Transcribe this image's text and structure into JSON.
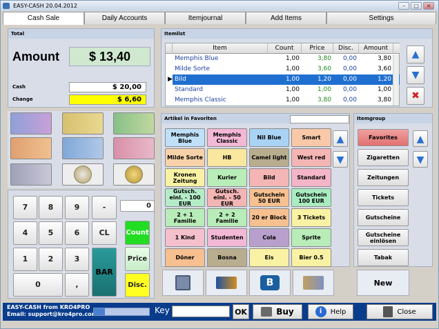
{
  "window": {
    "title": "EASY-CASH 20.04.2012",
    "controls": [
      "–",
      "□",
      "×"
    ]
  },
  "tabs": [
    {
      "label": "Cash Sale",
      "active": true
    },
    {
      "label": "Daily Accounts",
      "active": false
    },
    {
      "label": "Itemjournal",
      "active": false
    },
    {
      "label": "Add Items",
      "active": false
    },
    {
      "label": "Settings",
      "active": false
    }
  ],
  "total": {
    "header": "Total",
    "amount_label": "Amount",
    "amount_value": "$ 13,40",
    "cash_label": "Cash",
    "cash_value": "$ 20,00",
    "change_label": "Change",
    "change_value": "$ 6,60"
  },
  "itemlist": {
    "header": "Itemlist",
    "columns": [
      "Item",
      "Count",
      "Price",
      "Disc.",
      "Amount"
    ],
    "rows": [
      {
        "item": "Memphis Blue",
        "count": "1,00",
        "price": "3,80",
        "disc": "0,00",
        "amount": "3,80",
        "selected": false
      },
      {
        "item": "Milde Sorte",
        "count": "1,00",
        "price": "3,60",
        "disc": "0,00",
        "amount": "3,60",
        "selected": false
      },
      {
        "item": "Bild",
        "count": "1,00",
        "price": "1,20",
        "disc": "0,00",
        "amount": "1,20",
        "selected": true
      },
      {
        "item": "Standard",
        "count": "1,00",
        "price": "1,00",
        "disc": "0,00",
        "amount": "1,00",
        "selected": false
      },
      {
        "item": "Memphis  Classic",
        "count": "1,00",
        "price": "3,80",
        "disc": "0,00",
        "amount": "3,80",
        "selected": false
      }
    ]
  },
  "keypad": {
    "display": "0",
    "keys": [
      "7",
      "8",
      "9",
      "-",
      "4",
      "5",
      "6",
      "CL",
      "1",
      "2",
      "3",
      "BAR",
      "0",
      ","
    ],
    "count_label": "Count",
    "price_label": "Price",
    "disc_label": "Disc."
  },
  "favorites": {
    "header": "Artikel in Favoriten",
    "items": [
      {
        "label": "Memphis Blue",
        "color": "#bfe0f8"
      },
      {
        "label": "Memphis Classic",
        "color": "#f2b8d6"
      },
      {
        "label": "Nil Blue",
        "color": "#a9d3f5"
      },
      {
        "label": "Smart",
        "color": "#f8c8a8"
      },
      {
        "label": "Milde Sorte",
        "color": "#f7d2a8"
      },
      {
        "label": "HB",
        "color": "#f9e7a0"
      },
      {
        "label": "Camel light",
        "color": "#b8ad8e"
      },
      {
        "label": "West red",
        "color": "#f4b5b5"
      },
      {
        "label": "Kronen Zeitung",
        "color": "#f9f2a4"
      },
      {
        "label": "Kurier",
        "color": "#b8ecb8"
      },
      {
        "label": "Bild",
        "color": "#f4b5b5"
      },
      {
        "label": "Standard",
        "color": "#f4b5c8"
      },
      {
        "label": "Gutsch. einl. - 100 EUR",
        "color": "#b5ecc8"
      },
      {
        "label": "Gutsch. einl. - 50 EUR",
        "color": "#f4b5b5"
      },
      {
        "label": "Gutschein 50 EUR",
        "color": "#f7c090"
      },
      {
        "label": "Gutschein 100 EUR",
        "color": "#a8ecc0"
      },
      {
        "label": "2 + 1 Familie",
        "color": "#b8ecb8"
      },
      {
        "label": "2 + 2 Familie",
        "color": "#b8ecb8"
      },
      {
        "label": "20 er Block",
        "color": "#f7c090"
      },
      {
        "label": "3 Tickets",
        "color": "#f9f2a4"
      },
      {
        "label": "1 Kind",
        "color": "#f4c0cc"
      },
      {
        "label": "Studenten",
        "color": "#f2b8d6"
      },
      {
        "label": "Cola",
        "color": "#b8a0cc"
      },
      {
        "label": "Sprite",
        "color": "#b8ecb8"
      },
      {
        "label": "Döner",
        "color": "#f7c090"
      },
      {
        "label": "Bosna",
        "color": "#b8ad8e"
      },
      {
        "label": "Eis",
        "color": "#f9f2a4"
      },
      {
        "label": "Bier 0.5",
        "color": "#f9f2a4"
      }
    ]
  },
  "itemgroup": {
    "header": "Itemgroup",
    "items": [
      "Favorites",
      "Zigaretten",
      "Zeitungen",
      "Tickets",
      "Gutscheine",
      "Gutscheine einlösen",
      "Tabak"
    ],
    "new_label": "New"
  },
  "status": {
    "title": "EASY-CASH from KRO4PRO",
    "email": "Email: support@kro4pro.com",
    "key_label": "Key",
    "ok_label": "OK",
    "buy_label": "Buy",
    "help_label": "Help",
    "close_label": "Close"
  },
  "colors": {
    "selected_row": "#1f6fd0",
    "status_bar": "#0a3c8c",
    "change_bg": "#ffff00",
    "count_btn": "#22dd22",
    "disc_btn": "#ffff22",
    "bar_btn": "#1f8a8a"
  }
}
